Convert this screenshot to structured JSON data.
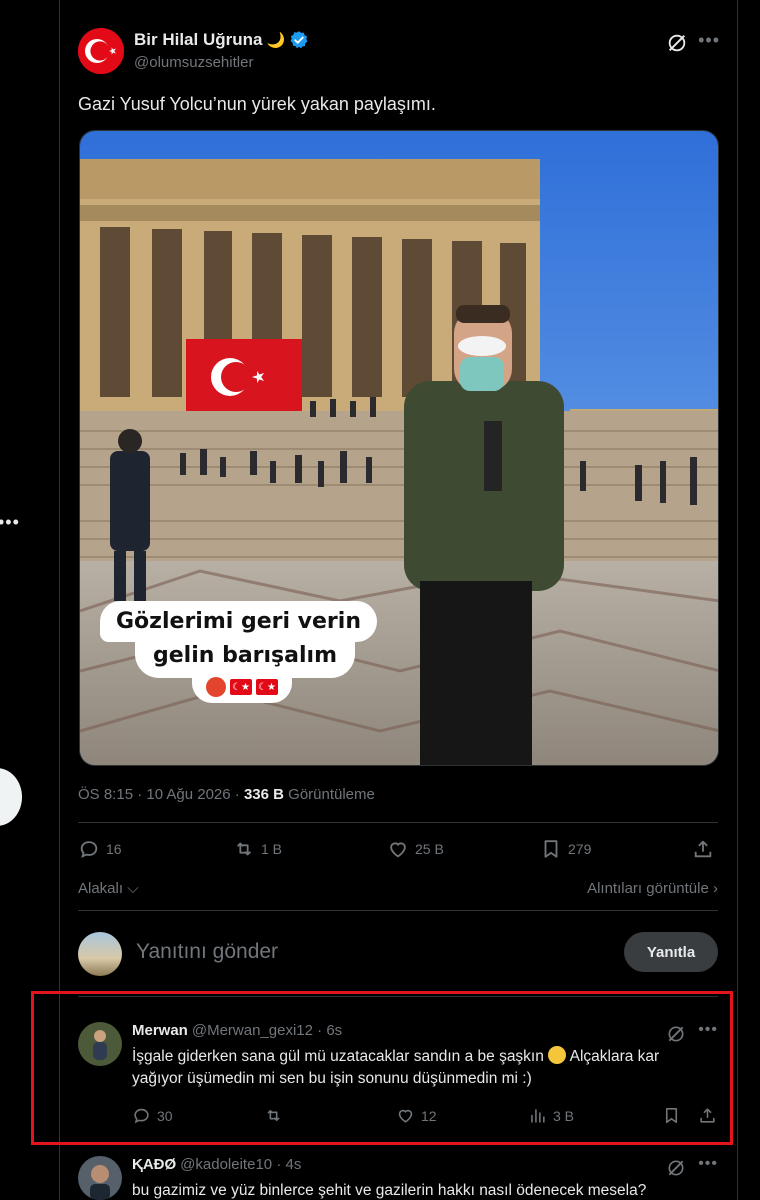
{
  "post": {
    "author_name": "Bir Hilal Uğruna",
    "author_handle": "@olumsuzsehitler",
    "text": "Gazi Yusuf Yolcu’nun yürek yakan paylaşımı.",
    "image_overlay": {
      "line1": "Gözlerimi geri verin",
      "line2": "gelin barışalım"
    },
    "time": "ÖS 8:15 · 10 Ağu 2026 · ",
    "views": "336 B",
    "views_label": " Görüntüleme",
    "stats": {
      "replies": "16",
      "reposts": "1 B",
      "likes": "25 B",
      "bookmarks": "279"
    },
    "sort_left": "Alakalı",
    "sort_right": "Alıntıları görüntüle"
  },
  "reply_box": {
    "placeholder": "Yanıtını gönder",
    "button": "Yanıtla"
  },
  "comments": [
    {
      "name": "Merwan",
      "handle": "@Merwan_gexi12",
      "time": "· 6s",
      "text_a": "İşgale giderken sana gül mü uzatacaklar sandın a be  şaşkın ",
      "text_b": " Alçaklara kar yağıyor üşümedin mi sen bu işin sonunu düşünmedin mi :)",
      "replies": "30",
      "reposts": "",
      "likes": "12",
      "views": "3 B"
    },
    {
      "name": "ⱩΑĐØ",
      "handle": "@kadoleite10",
      "time": "· 4s",
      "text_a": "bu gazimiz ve yüz binlerce şehit ve gazilerin hakkı nasıl ödenecek mesela?"
    }
  ],
  "colors": {
    "background": "#000000",
    "text": "#e7e9ea",
    "muted": "#71767b",
    "verified": "#1d9bf0",
    "highlight": "#e3141b"
  }
}
